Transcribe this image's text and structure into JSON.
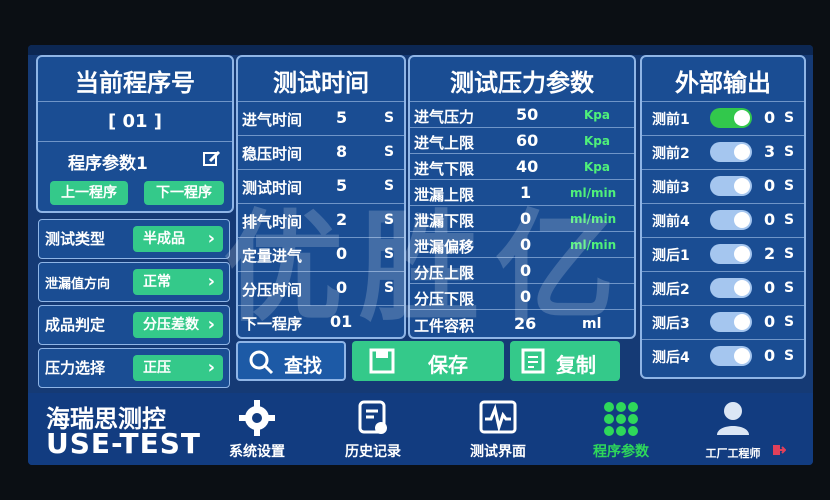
{
  "program": {
    "title": "当前程序号",
    "number": "[ 01 ]",
    "params_label": "程序参数1",
    "prev_label": "上一程序",
    "next_label": "下一程序"
  },
  "settings": [
    {
      "label": "测试类型",
      "value": "半成品"
    },
    {
      "label": "泄漏值方向",
      "value": "正常"
    },
    {
      "label": "成品判定",
      "value": "分压差数"
    },
    {
      "label": "压力选择",
      "value": "正压"
    }
  ],
  "test_time": {
    "title": "测试时间",
    "rows": [
      {
        "label": "进气时间",
        "value": "5",
        "unit": "S"
      },
      {
        "label": "稳压时间",
        "value": "8",
        "unit": "S"
      },
      {
        "label": "测试时间",
        "value": "5",
        "unit": "S"
      },
      {
        "label": "排气时间",
        "value": "2",
        "unit": "S"
      },
      {
        "label": "定量进气",
        "value": "0",
        "unit": "S"
      },
      {
        "label": "分压时间",
        "value": "0",
        "unit": "S"
      },
      {
        "label": "下一程序",
        "value": "01",
        "unit": ""
      }
    ]
  },
  "pressure": {
    "title": "测试压力参数",
    "rows": [
      {
        "label": "进气压力",
        "value": "50",
        "unit": "Kpa"
      },
      {
        "label": "进气上限",
        "value": "60",
        "unit": "Kpa"
      },
      {
        "label": "进气下限",
        "value": "40",
        "unit": "Kpa"
      },
      {
        "label": "泄漏上限",
        "value": "1",
        "unit": "ml/min"
      },
      {
        "label": "泄漏下限",
        "value": "0",
        "unit": "ml/min"
      },
      {
        "label": "泄漏偏移",
        "value": "0",
        "unit": "ml/min"
      },
      {
        "label": "分压上限",
        "value": "0",
        "unit": ""
      },
      {
        "label": "分压下限",
        "value": "0",
        "unit": ""
      },
      {
        "label": "工件容积",
        "value": "26",
        "unit": "ml"
      }
    ]
  },
  "output": {
    "title": "外部输出",
    "rows": [
      {
        "label": "测前1",
        "value": "0",
        "unit": "S",
        "on": true
      },
      {
        "label": "测前2",
        "value": "3",
        "unit": "S",
        "on": false
      },
      {
        "label": "测前3",
        "value": "0",
        "unit": "S",
        "on": false
      },
      {
        "label": "测前4",
        "value": "0",
        "unit": "S",
        "on": false
      },
      {
        "label": "测后1",
        "value": "2",
        "unit": "S",
        "on": false
      },
      {
        "label": "测后2",
        "value": "0",
        "unit": "S",
        "on": false
      },
      {
        "label": "测后3",
        "value": "0",
        "unit": "S",
        "on": false
      },
      {
        "label": "测后4",
        "value": "0",
        "unit": "S",
        "on": false
      }
    ]
  },
  "actions": {
    "search": "查找",
    "save": "保存",
    "copy": "复制"
  },
  "brand": {
    "line1": "海瑞思测控",
    "line2": "USE-TEST"
  },
  "nav": {
    "settings": "系统设置",
    "history": "历史记录",
    "test_ui": "测试界面",
    "program_params": "程序参数",
    "engineer": "工厂工程师"
  },
  "watermark": "优胜亿",
  "colors": {
    "accent_green": "#34c98a",
    "panel_blue": "#1a4d93",
    "active_nav_green": "#2ed85a"
  }
}
